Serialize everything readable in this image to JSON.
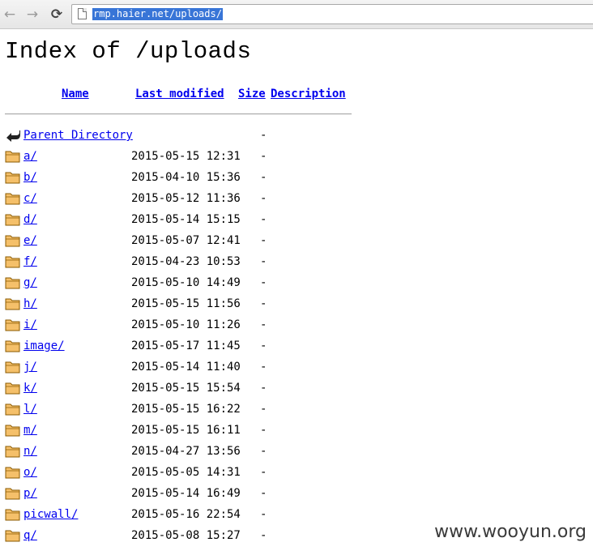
{
  "browser": {
    "url": "rmp.haier.net/uploads/",
    "back_glyph": "←",
    "forward_glyph": "→",
    "reload_glyph": "⟳"
  },
  "page": {
    "title": "Index of /uploads",
    "columns": {
      "name": "Name",
      "last_modified": "Last modified",
      "size": "Size",
      "description": "Description"
    },
    "entries": [
      {
        "icon": "parent-directory-icon",
        "name": "Parent Directory",
        "date": "",
        "size": "-"
      },
      {
        "icon": "folder-icon",
        "name": "a/",
        "date": "2015-05-15 12:31",
        "size": "-"
      },
      {
        "icon": "folder-icon",
        "name": "b/",
        "date": "2015-04-10 15:36",
        "size": "-"
      },
      {
        "icon": "folder-icon",
        "name": "c/",
        "date": "2015-05-12 11:36",
        "size": "-"
      },
      {
        "icon": "folder-icon",
        "name": "d/",
        "date": "2015-05-14 15:15",
        "size": "-"
      },
      {
        "icon": "folder-icon",
        "name": "e/",
        "date": "2015-05-07 12:41",
        "size": "-"
      },
      {
        "icon": "folder-icon",
        "name": "f/",
        "date": "2015-04-23 10:53",
        "size": "-"
      },
      {
        "icon": "folder-icon",
        "name": "g/",
        "date": "2015-05-10 14:49",
        "size": "-"
      },
      {
        "icon": "folder-icon",
        "name": "h/",
        "date": "2015-05-15 11:56",
        "size": "-"
      },
      {
        "icon": "folder-icon",
        "name": "i/",
        "date": "2015-05-10 11:26",
        "size": "-"
      },
      {
        "icon": "folder-icon",
        "name": "image/",
        "date": "2015-05-17 11:45",
        "size": "-"
      },
      {
        "icon": "folder-icon",
        "name": "j/",
        "date": "2015-05-14 11:40",
        "size": "-"
      },
      {
        "icon": "folder-icon",
        "name": "k/",
        "date": "2015-05-15 15:54",
        "size": "-"
      },
      {
        "icon": "folder-icon",
        "name": "l/",
        "date": "2015-05-15 16:22",
        "size": "-"
      },
      {
        "icon": "folder-icon",
        "name": "m/",
        "date": "2015-05-15 16:11",
        "size": "-"
      },
      {
        "icon": "folder-icon",
        "name": "n/",
        "date": "2015-04-27 13:56",
        "size": "-"
      },
      {
        "icon": "folder-icon",
        "name": "o/",
        "date": "2015-05-05 14:31",
        "size": "-"
      },
      {
        "icon": "folder-icon",
        "name": "p/",
        "date": "2015-05-14 16:49",
        "size": "-"
      },
      {
        "icon": "folder-icon",
        "name": "picwall/",
        "date": "2015-05-16 22:54",
        "size": "-"
      },
      {
        "icon": "folder-icon",
        "name": "q/",
        "date": "2015-05-08 15:27",
        "size": "-"
      }
    ]
  },
  "watermark": "www.wooyun.org",
  "colors": {
    "link": "#0000ee",
    "url_selection": "#3875d7",
    "folder_fill": "#f5c06a",
    "folder_stroke": "#8a5a00"
  }
}
